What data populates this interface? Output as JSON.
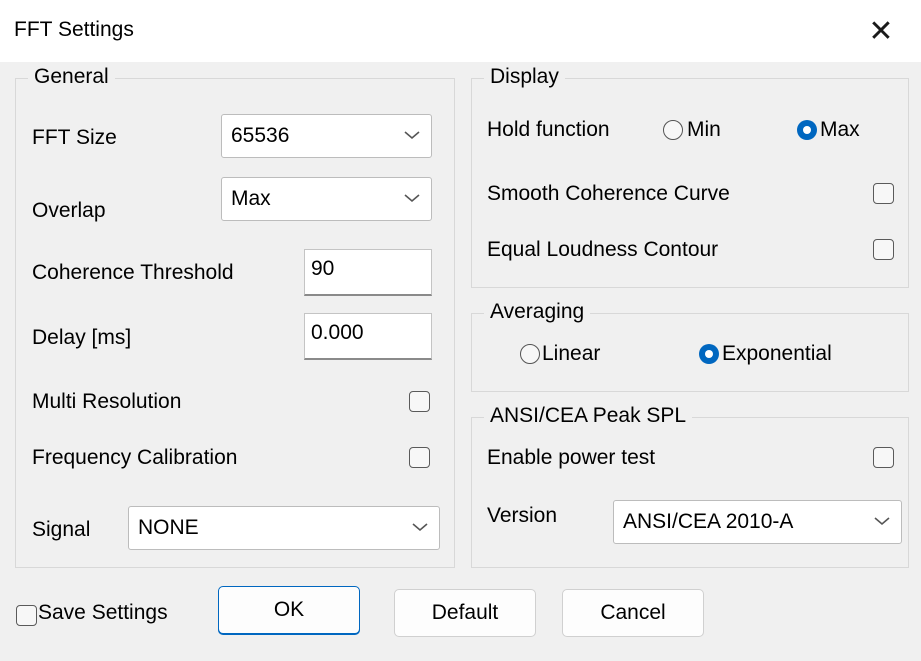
{
  "window": {
    "title": "FFT Settings",
    "close_glyph": "✕"
  },
  "general": {
    "legend": "General",
    "fft_size": {
      "label": "FFT Size",
      "value": "65536"
    },
    "overlap": {
      "label": "Overlap",
      "value": "Max"
    },
    "coherence_threshold": {
      "label": "Coherence Threshold",
      "value": "90"
    },
    "delay": {
      "label": "Delay [ms]",
      "value": "0.000"
    },
    "multi_resolution": {
      "label": "Multi Resolution",
      "checked": false
    },
    "frequency_calibration": {
      "label": "Frequency Calibration",
      "checked": false
    },
    "signal": {
      "label": "Signal",
      "value": "NONE"
    }
  },
  "display": {
    "legend": "Display",
    "hold_function": {
      "label": "Hold function",
      "options": [
        "Min",
        "Max"
      ],
      "selected": "Max"
    },
    "smooth_coherence": {
      "label": "Smooth Coherence Curve",
      "checked": false
    },
    "equal_loudness": {
      "label": "Equal Loudness Contour",
      "checked": false
    }
  },
  "averaging": {
    "legend": "Averaging",
    "options": [
      "Linear",
      "Exponential"
    ],
    "selected": "Exponential"
  },
  "ansi": {
    "legend": "ANSI/CEA Peak SPL",
    "power_test": {
      "label": "Enable power test",
      "checked": false
    },
    "version": {
      "label": "Version",
      "value": "ANSI/CEA 2010-A"
    }
  },
  "footer": {
    "save_settings": {
      "label": "Save Settings",
      "checked": false
    },
    "ok_label": "OK",
    "default_label": "Default",
    "cancel_label": "Cancel"
  },
  "colors": {
    "accent": "#0067c0",
    "background": "#f0f0f0",
    "titlebar": "#ffffff"
  }
}
